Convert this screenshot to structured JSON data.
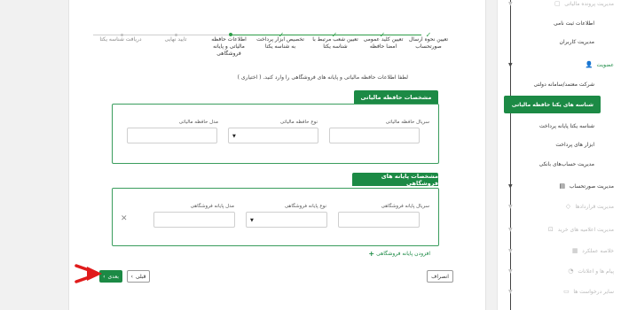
{
  "stepper": {
    "steps": [
      {
        "label": "تعیین نحوه ارسال صورتحساب",
        "state": "done"
      },
      {
        "label": "تعیین کلید عمومی امضا حافظه",
        "state": "done"
      },
      {
        "label": "تعیین شعب مرتبط با شناسه یکتا",
        "state": "done"
      },
      {
        "label": "تخصیص ابزار پرداخت به شناسه یکتا",
        "state": "done"
      },
      {
        "label": "اطلاعات حافظه مالیاتی و پایانه فروشگاهی",
        "state": "current"
      },
      {
        "label": "تایید نهایی",
        "state": "pending"
      },
      {
        "label": "دریافت شناسه یکتا",
        "state": "pending"
      }
    ]
  },
  "intro_text": "لطفا اطلاعات حافظه مالیاتی و پایانه های فروشگاهی را وارد کنید. ( اختیاری )",
  "memory_section": {
    "title": "مشخصات حافظه مالیاتی",
    "serial_label": "سریال حافظه مالیاتی",
    "type_label": "نوع حافظه مالیاتی",
    "model_label": "مدل حافظه مالیاتی"
  },
  "terminal_section": {
    "title": "مشخصات پایانه های فروشگاهی",
    "serial_label": "سریال پایانه فروشگاهی",
    "type_label": "نوع پایانه فروشگاهی",
    "model_label": "مدل پایانه فروشگاهی",
    "remove_icon": "close-icon"
  },
  "add_terminal_label": "افزودن پایانه فروشگاهی",
  "buttons": {
    "next": "بعدی",
    "prev": "قبلی",
    "cancel": "انصراف"
  },
  "sidebar": {
    "items": [
      {
        "label": "مدیریت پرونده مالیاتی",
        "state": "disabled",
        "expander": true
      },
      {
        "label": "اطلاعات ثبت نامی",
        "state": "normal",
        "expander": false
      },
      {
        "label": "مدیریت کاربران",
        "state": "normal",
        "expander": false
      },
      {
        "label": "عضویت",
        "state": "active",
        "expander": true
      },
      {
        "label": "شرکت معتمد/سامانه دولتی",
        "state": "normal",
        "expander": false
      },
      {
        "label": "شناسه های یکتا حافظه مالیاتی",
        "state": "selected",
        "expander": false
      },
      {
        "label": "شناسه یکتا پایانه پرداخت",
        "state": "normal",
        "expander": false
      },
      {
        "label": "ابزار های پرداخت",
        "state": "normal",
        "expander": false
      },
      {
        "label": "مدیریت حساب‌های بانکی",
        "state": "normal",
        "expander": false
      },
      {
        "label": "مدیریت صورتحساب",
        "state": "normal",
        "expander": true
      },
      {
        "label": "مدیریت قراردادها",
        "state": "disabled",
        "expander": true
      },
      {
        "label": "مدیریت اعلامیه های خرید",
        "state": "disabled",
        "expander": true
      },
      {
        "label": "خلاصه عملکرد",
        "state": "disabled",
        "expander": true
      },
      {
        "label": "پیام ها و اعلانات",
        "state": "disabled",
        "expander": true
      },
      {
        "label": "سایر درخواست ها",
        "state": "disabled",
        "expander": true
      }
    ]
  },
  "colors": {
    "accent": "#1c8a45",
    "arrow": "#e01b1b"
  }
}
